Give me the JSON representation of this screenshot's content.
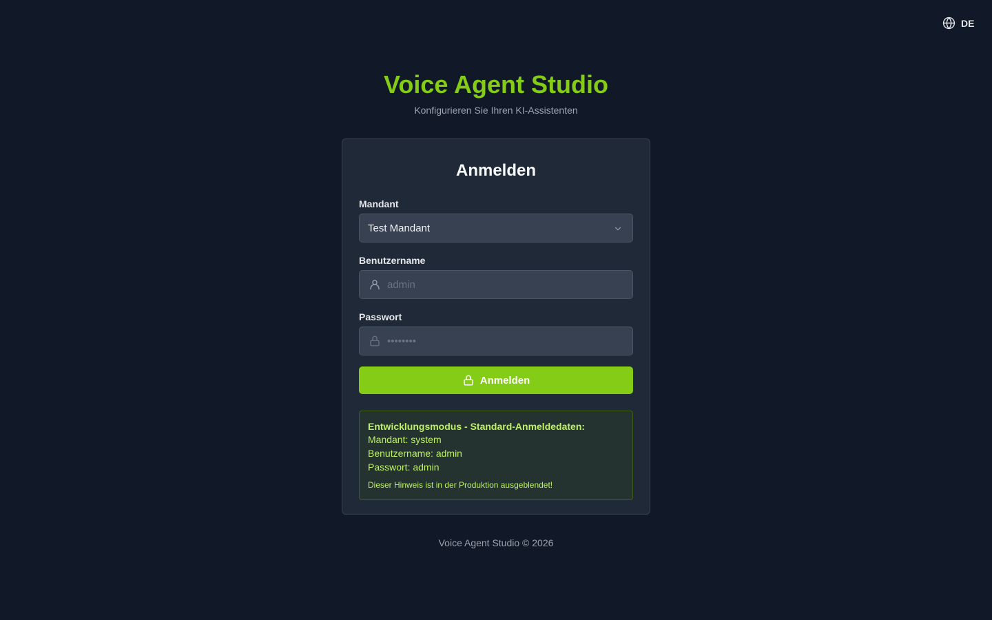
{
  "language": {
    "code": "DE",
    "icon": "globe-icon"
  },
  "header": {
    "title": "Voice Agent Studio",
    "subtitle": "Konfigurieren Sie Ihren KI-Assistenten"
  },
  "login": {
    "title": "Anmelden",
    "tenant": {
      "label": "Mandant",
      "value": "Test Mandant",
      "icon": "chevron-down-icon"
    },
    "username": {
      "label": "Benutzername",
      "placeholder": "admin",
      "icon": "user-icon"
    },
    "password": {
      "label": "Passwort",
      "placeholder": "••••••••",
      "icon": "lock-icon"
    },
    "submit_label": "Anmelden"
  },
  "dev_note": {
    "title": "Entwicklungsmodus - Standard-Anmeldedaten:",
    "tenant_line": "Mandant: system",
    "username_line": "Benutzername: admin",
    "password_line": "Passwort: admin",
    "hint": "Dieser Hinweis ist in der Produktion ausgeblendet!"
  },
  "footer": {
    "text": "Voice Agent Studio © 2026"
  },
  "colors": {
    "background": "#111827",
    "card": "#1f2937",
    "accent": "#84cc16",
    "note_text": "#bef264"
  }
}
